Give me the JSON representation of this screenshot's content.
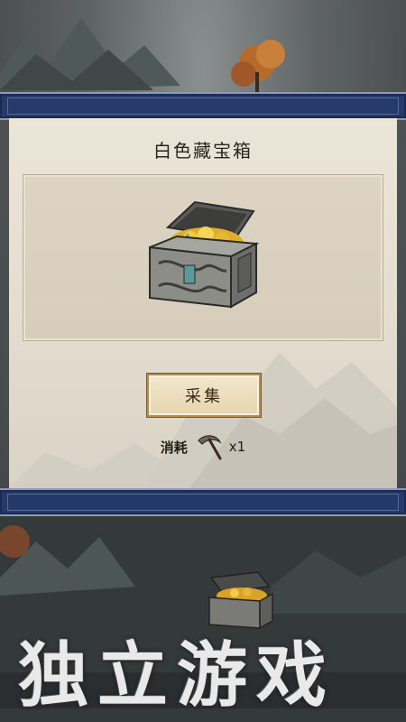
{
  "popup": {
    "title": "白色藏宝箱",
    "item_icon": "treasure-chest-icon",
    "collect_label": "采集",
    "cost": {
      "label": "消耗",
      "icon": "pickaxe-icon",
      "quantity": "x1"
    }
  },
  "watermark": "独立游戏",
  "colors": {
    "frame_navy": "#263a6a",
    "parchment": "#e6dfd2",
    "button_gold": "#e6d6b0"
  }
}
